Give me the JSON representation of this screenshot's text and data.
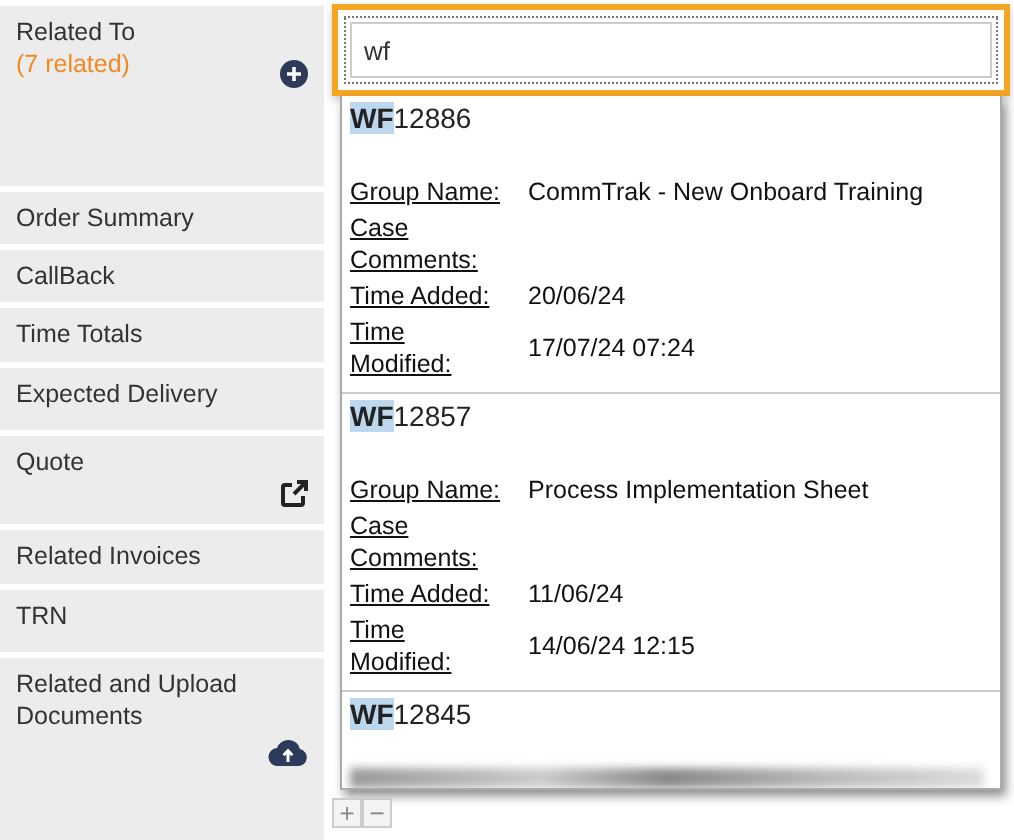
{
  "sidebar": {
    "items": [
      {
        "label": "Related To",
        "sublabel": "(7 related)",
        "kind": "add"
      },
      {
        "label": "Order Summary"
      },
      {
        "label": "CallBack"
      },
      {
        "label": "Time Totals"
      },
      {
        "label": "Expected Delivery"
      },
      {
        "label": "Quote",
        "kind": "link"
      },
      {
        "label": "Related Invoices"
      },
      {
        "label": "TRN"
      },
      {
        "label": "Related and Upload Documents",
        "kind": "upload"
      }
    ]
  },
  "search": {
    "value": "wf"
  },
  "results": [
    {
      "match": "WF",
      "rest": "12886",
      "fields": [
        {
          "label": "Group Name:",
          "value": "CommTrak - New Onboard Training"
        },
        {
          "label": "Case Comments:"
        },
        {
          "label": "Time Added:",
          "value": "20/06/24"
        },
        {
          "label": "Time Modified:",
          "value": "17/07/24 07:24"
        }
      ]
    },
    {
      "match": "WF",
      "rest": "12857",
      "fields": [
        {
          "label": "Group Name:",
          "value": "Process Implementation Sheet"
        },
        {
          "label": "Case Comments:"
        },
        {
          "label": "Time Added:",
          "value": "11/06/24"
        },
        {
          "label": "Time Modified:",
          "value": "14/06/24 12:15"
        }
      ]
    },
    {
      "match": "WF",
      "rest": "12845",
      "blurred": true
    }
  ],
  "list_buttons": [
    "+",
    "−"
  ]
}
